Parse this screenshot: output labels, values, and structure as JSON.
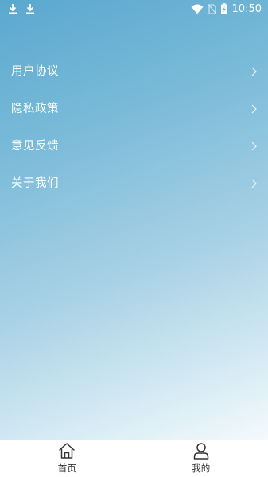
{
  "status_bar": {
    "time": "10:50",
    "left_icons": [
      "download-icon",
      "download-icon"
    ],
    "right_icons": [
      "wifi-icon",
      "no-sim-icon",
      "battery-charging-icon"
    ]
  },
  "menu": {
    "items": [
      {
        "label": "用户协议",
        "icon": "chevron-right-icon"
      },
      {
        "label": "隐私政策",
        "icon": "chevron-right-icon"
      },
      {
        "label": "意见反馈",
        "icon": "chevron-right-icon"
      },
      {
        "label": "关于我们",
        "icon": "chevron-right-icon"
      }
    ]
  },
  "bottom_nav": {
    "tabs": [
      {
        "label": "首页",
        "icon": "home-icon"
      },
      {
        "label": "我的",
        "icon": "profile-icon"
      }
    ]
  },
  "colors": {
    "gradient_top": "#5aa8cf",
    "gradient_bottom": "#f4fafd",
    "text": "#ffffff",
    "nav_background": "#ffffff",
    "nav_text": "#333333"
  }
}
